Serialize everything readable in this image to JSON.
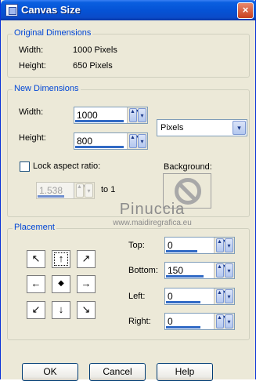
{
  "window": {
    "title": "Canvas Size",
    "close_glyph": "×"
  },
  "original": {
    "legend": "Original Dimensions",
    "width_label": "Width:",
    "width_value": "1000 Pixels",
    "height_label": "Height:",
    "height_value": "650 Pixels"
  },
  "new_dims": {
    "legend": "New Dimensions",
    "width_label": "Width:",
    "width_value": "1000",
    "height_label": "Height:",
    "height_value": "800",
    "units_value": "Pixels",
    "lock_label": "Lock aspect ratio:",
    "ratio_value": "1.538",
    "to_label": "to 1",
    "background_label": "Background:"
  },
  "watermark": {
    "line1": "Pinuccia",
    "line2": "www.maidiregrafica.eu"
  },
  "placement": {
    "legend": "Placement",
    "arrows": [
      "↖",
      "↑",
      "↗",
      "←",
      "◆",
      "→",
      "↙",
      "↓",
      "↘"
    ],
    "top_label": "Top:",
    "top_value": "0",
    "bottom_label": "Bottom:",
    "bottom_value": "150",
    "left_label": "Left:",
    "left_value": "0",
    "right_label": "Right:",
    "right_value": "0"
  },
  "buttons": {
    "ok": "OK",
    "cancel": "Cancel",
    "help": "Help"
  },
  "glyphs": {
    "updown": "▲▼",
    "dropdown": "▾"
  },
  "colors": {
    "accent": "#0046d5",
    "titlebar": "#0553d6",
    "selection": "#316ac5"
  }
}
